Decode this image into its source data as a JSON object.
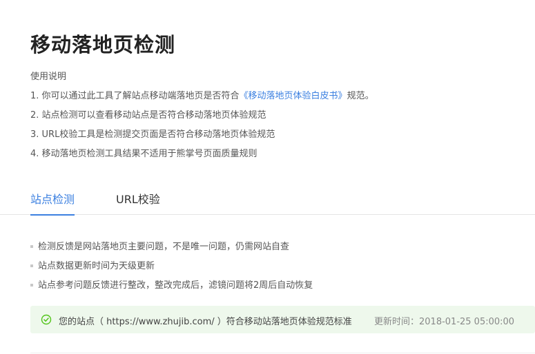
{
  "page": {
    "title": "移动落地页检测",
    "usage_heading": "使用说明",
    "instructions": [
      {
        "prefix": "1. 你可以通过此工具了解站点移动端落地页是否符合",
        "link": "《移动落地页体验白皮书》",
        "suffix": "规范。"
      },
      {
        "text": "2. 站点检测可以查看移动站点是否符合移动落地页体验规范"
      },
      {
        "text": "3. URL校验工具是检测提交页面是否符合移动落地页体验规范"
      },
      {
        "text": "4. 移动落地页检测工具结果不适用于熊掌号页面质量规则"
      }
    ]
  },
  "tabs": [
    {
      "label": "站点检测",
      "active": true
    },
    {
      "label": "URL校验",
      "active": false
    }
  ],
  "notes": [
    "检测反馈是网站落地页主要问题，不是唯一问题，仍需网站自查",
    "站点数据更新时间为天级更新",
    "站点参考问题反馈进行整改，整改完成后，滤镜问题将2周后自动恢复"
  ],
  "result": {
    "message": "您的站点（ https://www.zhujib.com/ ）符合移动站落地页体验规范标准",
    "updated": "更新时间：2018-01-25 05:00:00",
    "status_icon": "check-circle-icon",
    "status_color": "#52c41a"
  },
  "colors": {
    "accent": "#3a7fe0",
    "notice_bg": "#eef8ec"
  }
}
